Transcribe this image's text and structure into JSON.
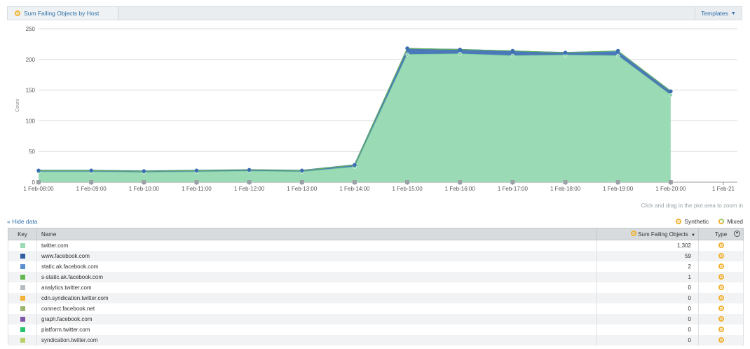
{
  "toolbar": {
    "title": "Sum Failing Objects by Host",
    "title_icon": "synthetic-icon",
    "templates_label": "Templates"
  },
  "chart_data": {
    "type": "area",
    "ylabel": "Count",
    "xlabel": "",
    "ylim": [
      0,
      250
    ],
    "yticks": [
      0,
      50,
      100,
      150,
      200,
      250
    ],
    "grid": true,
    "x": [
      "1 Feb-08:00",
      "1 Feb-09:00",
      "1 Feb-10:00",
      "1 Feb-11:00",
      "1 Feb-12:00",
      "1 Feb-13:00",
      "1 Feb-14:00",
      "1 Feb-15:00",
      "1 Feb-16:00",
      "1 Feb-17:00",
      "1 Feb-18:00",
      "1 Feb-19:00",
      "1 Feb-20:00",
      "1 Feb-21"
    ],
    "stacked": true,
    "series": [
      {
        "name": "twitter.com",
        "color": "#9adbb5",
        "values": [
          17,
          17,
          16,
          17,
          18,
          17,
          25,
          208,
          209,
          206,
          207,
          206,
          142,
          null
        ]
      },
      {
        "name": "www.facebook.com",
        "color": "#4a78b8",
        "values": [
          2,
          2,
          2,
          2,
          2,
          2,
          3,
          9,
          7,
          7,
          4,
          7,
          6,
          null
        ]
      },
      {
        "name": "static.ak.facebook.com",
        "color": "#5b8fcf",
        "values": [
          0,
          0,
          0,
          0,
          0,
          0,
          0,
          1,
          0,
          1,
          0,
          0,
          0,
          null
        ]
      },
      {
        "name": "s-static.ak.facebook.com",
        "color": "#62b84f",
        "values": [
          0,
          0,
          0,
          0,
          0,
          0,
          0,
          0,
          0,
          0,
          0,
          1,
          0,
          null
        ]
      }
    ],
    "bottom_markers": "gray squares at zero line"
  },
  "hint": "Click and drag in the plot area to zoom in",
  "hide_data_label": "« Hide data",
  "legend": {
    "synthetic_label": "Synthetic",
    "mixed_label": "Mixed"
  },
  "table": {
    "headers": {
      "key": "Key",
      "name": "Name",
      "sum": "Sum Failing Objects",
      "type": "Type"
    },
    "rows": [
      {
        "color": "#9adbb5",
        "name": "twitter.com",
        "value": "1,302"
      },
      {
        "color": "#2f5fa0",
        "name": "www.facebook.com",
        "value": "59"
      },
      {
        "color": "#5b8fcf",
        "name": "static.ak.facebook.com",
        "value": "2"
      },
      {
        "color": "#62b84f",
        "name": "s-static.ak.facebook.com",
        "value": "1"
      },
      {
        "color": "#b5bcc2",
        "name": "analytics.twitter.com",
        "value": "0"
      },
      {
        "color": "#f2b233",
        "name": "cdn.syndication.twitter.com",
        "value": "0"
      },
      {
        "color": "#9bb56e",
        "name": "connect.facebook.net",
        "value": "0"
      },
      {
        "color": "#7e57a6",
        "name": "graph.facebook.com",
        "value": "0"
      },
      {
        "color": "#27c26b",
        "name": "platform.twitter.com",
        "value": "0"
      },
      {
        "color": "#b8cf6a",
        "name": "syndication.twitter.com",
        "value": "0"
      }
    ]
  }
}
